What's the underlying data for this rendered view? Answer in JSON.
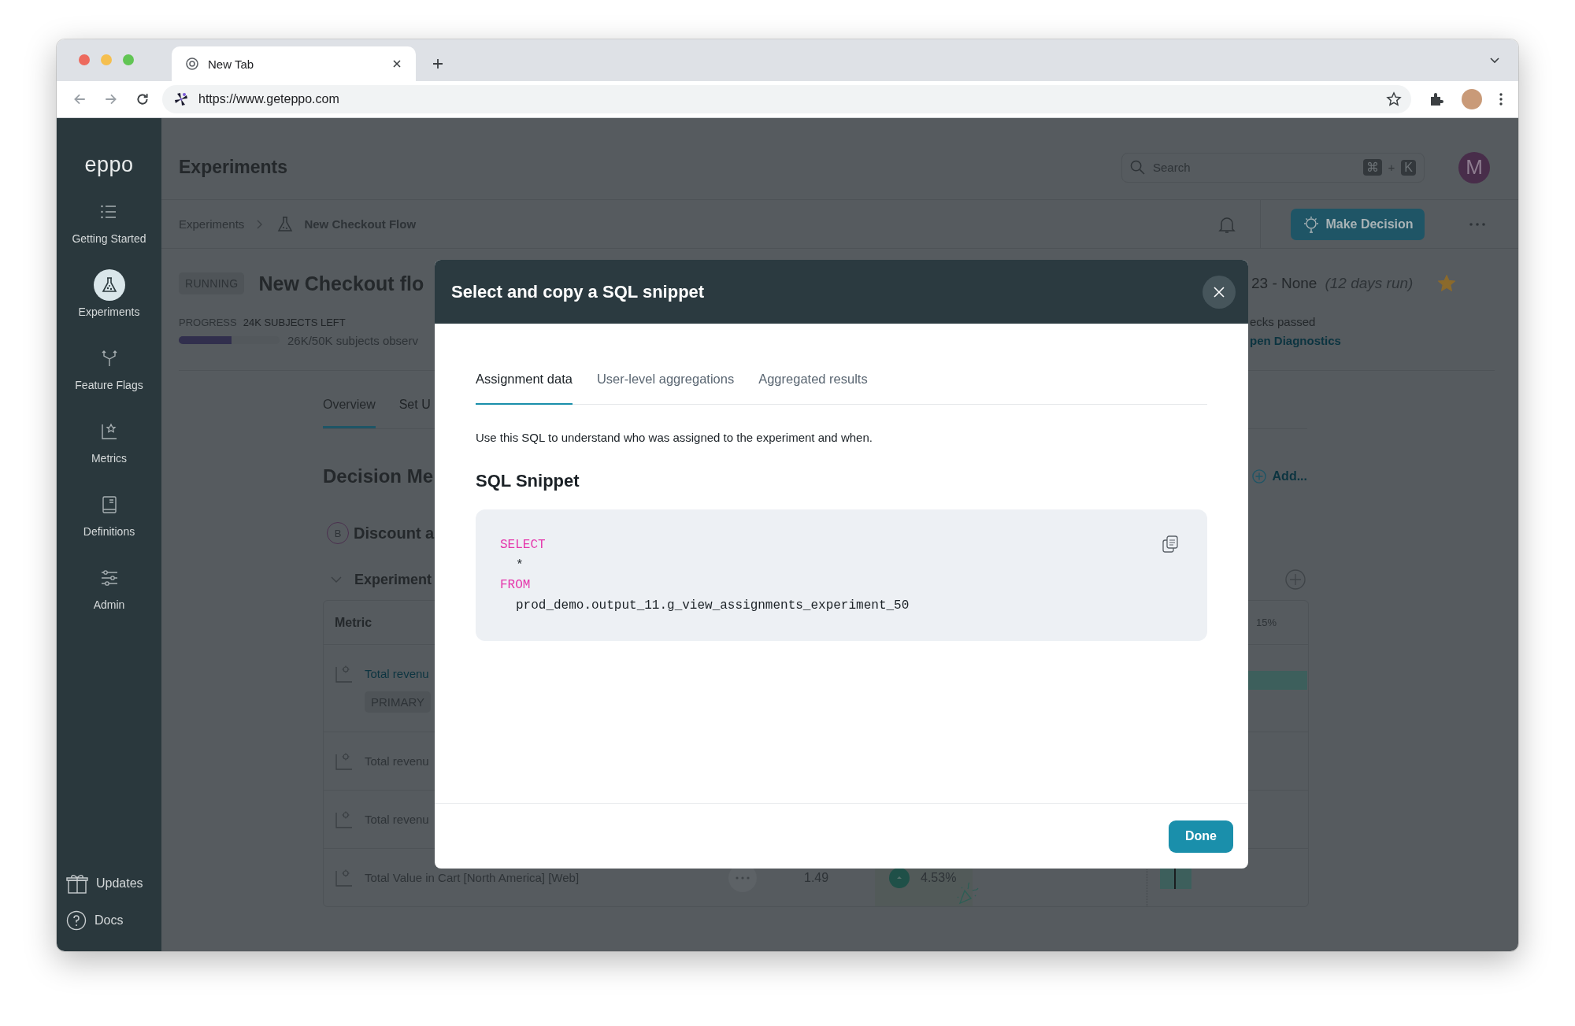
{
  "browser": {
    "tab_title": "New Tab",
    "url": "https://www.geteppo.com"
  },
  "sidebar": {
    "logo": "eppo",
    "items": [
      {
        "label": "Getting Started",
        "selected": false
      },
      {
        "label": "Experiments",
        "selected": true
      },
      {
        "label": "Feature Flags",
        "selected": false
      },
      {
        "label": "Metrics",
        "selected": false
      },
      {
        "label": "Definitions",
        "selected": false
      },
      {
        "label": "Admin",
        "selected": false
      }
    ],
    "footer_items": [
      {
        "label": "Updates"
      },
      {
        "label": "Docs"
      }
    ]
  },
  "header": {
    "title": "Experiments",
    "search": {
      "placeholder": "Search",
      "keys": [
        "⌘",
        "K"
      ],
      "separator": "+"
    },
    "avatar": "M"
  },
  "breadcrumb": {
    "items": [
      "Experiments",
      "New Checkout Flow"
    ],
    "action": "Make Decision"
  },
  "experiment": {
    "status": "RUNNING",
    "title": "New Checkout flo",
    "dates": "23 - None",
    "duration": "(12 days run)",
    "starred": true,
    "progress": {
      "label": "PROGRESS",
      "remaining": "24K SUBJECTS LEFT",
      "level": 0.52,
      "observed": "26K/50K subjects observ"
    },
    "checks": "ecks passed",
    "diagnostics_link": "pen Diagnostics"
  },
  "page_tabs": [
    {
      "label": "Overview",
      "selected": true
    },
    {
      "label": "Set U",
      "selected": false
    }
  ],
  "decision": {
    "title": "Decision Me",
    "add": "Add...",
    "variant": {
      "badge": "B",
      "name": "Discount a"
    },
    "section": {
      "title": "Experiment",
      "expanded": true
    }
  },
  "table": {
    "columns": [
      {
        "label": "Metric"
      },
      {
        "label": "15%"
      }
    ],
    "rows": [
      {
        "metric": "Total revenu",
        "link": true,
        "badge": "PRIMARY"
      },
      {
        "metric": "Total revenu",
        "link": false
      },
      {
        "metric": "Total revenu",
        "link": false
      },
      {
        "metric": "Total Value in Cart [North America] [Web]",
        "link": false,
        "value": "1.49",
        "lift": "4.53%"
      }
    ]
  },
  "modal": {
    "title": "Select and copy a SQL snippet",
    "tabs": [
      {
        "label": "Assignment data",
        "selected": true
      },
      {
        "label": "User-level aggregations",
        "selected": false
      },
      {
        "label": "Aggregated results",
        "selected": false
      }
    ],
    "description": "Use this SQL to understand who was assigned to the experiment and when.",
    "heading": "SQL Snippet",
    "code": [
      {
        "text": "SELECT",
        "kind": "keyword"
      },
      {
        "text": "*",
        "kind": "plain"
      },
      {
        "text": "FROM",
        "kind": "keyword"
      },
      {
        "text": "prod_demo.output_11.g_view_assignments_experiment_50",
        "kind": "plain"
      }
    ],
    "done": "Done"
  }
}
